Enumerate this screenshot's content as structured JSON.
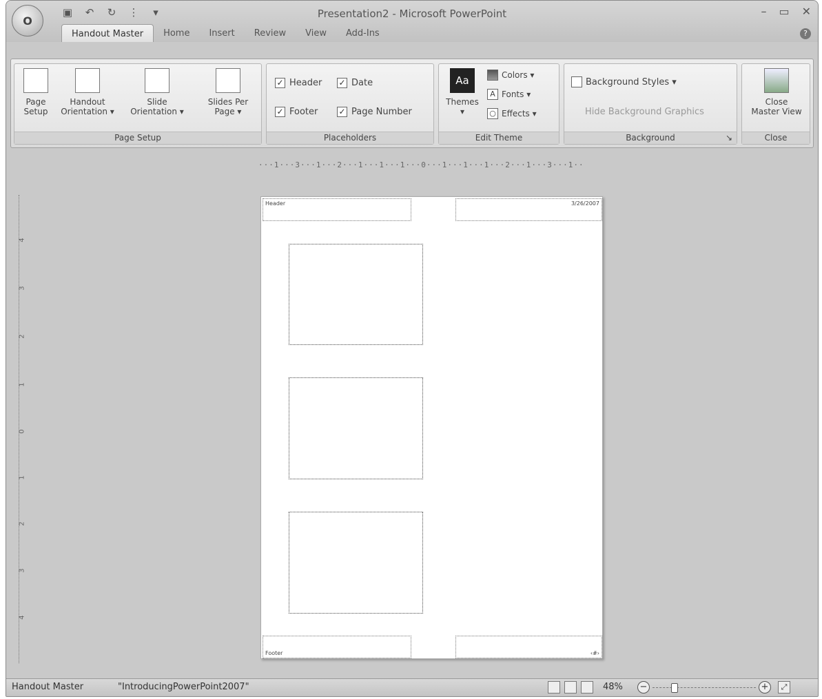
{
  "window": {
    "title": "Presentation2 - Microsoft PowerPoint"
  },
  "office_button": {
    "label": "O"
  },
  "qat": {
    "save": "▣",
    "undo": "↶",
    "redo": "↻",
    "more": "⋮",
    "dropdown": "▾"
  },
  "window_controls": {
    "minimize": "–",
    "maximize": "▭",
    "close": "✕"
  },
  "tabs": [
    "Handout Master",
    "Home",
    "Insert",
    "Review",
    "View",
    "Add-Ins"
  ],
  "help": "?",
  "ribbon": {
    "page_setup": {
      "label": "Page Setup",
      "buttons": [
        {
          "label1": "Page",
          "label2": "Setup"
        },
        {
          "label1": "Handout",
          "label2": "Orientation ▾"
        },
        {
          "label1": "Slide",
          "label2": "Orientation ▾"
        },
        {
          "label1": "Slides Per",
          "label2": "Page ▾"
        }
      ]
    },
    "placeholders": {
      "label": "Placeholders",
      "check": "✓",
      "header": "Header",
      "date": "Date",
      "footer": "Footer",
      "page_number": "Page Number"
    },
    "edit_theme": {
      "label": "Edit Theme",
      "themes_icon": "Aa",
      "themes": "Themes",
      "themes_arrow": "▾",
      "colors": "Colors ▾",
      "fonts_icon": "A",
      "fonts": "Fonts ▾",
      "effects_icon": "○",
      "effects": "Effects ▾"
    },
    "background": {
      "label": "Background",
      "styles": "Background Styles ▾",
      "hide": "Hide Background Graphics",
      "launcher": "↘"
    },
    "close": {
      "label": "Close",
      "btn1": "Close",
      "btn2": "Master View"
    }
  },
  "ruler": {
    "horizontal": "···1···3···1···2···1···1···1···0···1···1···1···2···1···3···1··",
    "vertical": [
      "4",
      "3",
      "2",
      "1",
      "0",
      "1",
      "2",
      "3",
      "4"
    ]
  },
  "page": {
    "header": "Header",
    "date": "3/26/2007",
    "footer": "Footer",
    "page_number": "‹#›"
  },
  "status": {
    "mode": "Handout Master",
    "theme": "\"IntroducingPowerPoint2007\"",
    "zoom": "48%",
    "zoom_out": "−",
    "zoom_in": "+",
    "fit": "⤢",
    "zoom_level": 0.48
  }
}
